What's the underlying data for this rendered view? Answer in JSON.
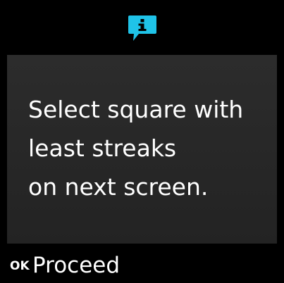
{
  "header": {
    "icon": "info-icon",
    "icon_color": "#1fc3e8"
  },
  "message": {
    "lines": [
      "Select square with",
      "least streaks",
      "on next screen."
    ]
  },
  "footer": {
    "ok_key_label": "OK",
    "proceed_label": "Proceed"
  },
  "colors": {
    "background": "#000000",
    "panel": "#282828",
    "text": "#ffffff"
  }
}
